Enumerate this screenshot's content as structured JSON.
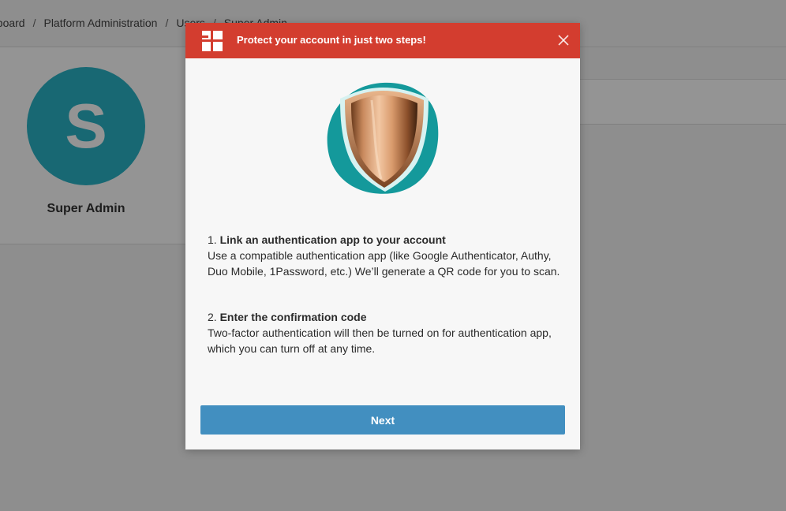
{
  "breadcrumb": {
    "items": [
      "Dashboard",
      "Platform Administration",
      "Users",
      "Super Admin"
    ],
    "visible_first": "hboard"
  },
  "profile": {
    "initial": "S",
    "name": "Super Admin",
    "avatar_color": "#2ab3c6"
  },
  "modal": {
    "title": "Protect your account in just two steps!",
    "header_color": "#d33d2f",
    "close_icon": "close-icon",
    "logo_icon": "app-logo-icon",
    "illustration_icon": "shield-icon",
    "steps": [
      {
        "number": "1.",
        "title": "Link an authentication app to your account",
        "body": "Use a compatible authentication app (like Google Authenticator, Authy, Duo Mobile, 1Password, etc.) We’ll generate a QR code for you to scan."
      },
      {
        "number": "2.",
        "title": "Enter the confirmation code",
        "body": "Two-factor authentication will then be turned on for authentication app, which you can turn off at any time."
      }
    ],
    "next_label": "Next",
    "button_color": "#428fc0"
  }
}
